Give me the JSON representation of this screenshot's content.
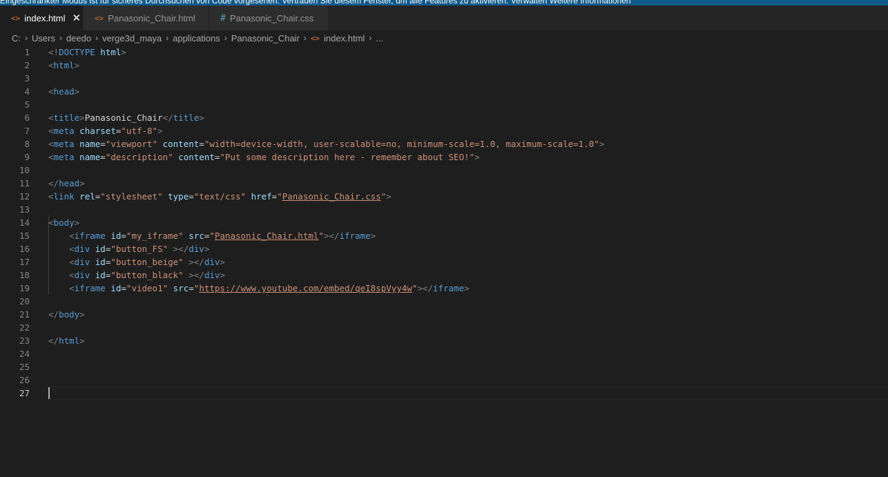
{
  "notification": {
    "text": "Eingeschränkter Modus ist für sicheres Durchsuchen von Code vorgesehen. Vertrauen Sie diesem Fenster, um alle Features zu aktivieren.   Verwalten   Weitere Informationen"
  },
  "tabs": [
    {
      "label": "index.html",
      "icon": "html-file-icon",
      "active": true
    },
    {
      "label": "Panasonic_Chair.html",
      "icon": "html-file-icon",
      "active": false
    },
    {
      "label": "Panasonic_Chair.css",
      "icon": "css-file-icon",
      "active": false
    }
  ],
  "breadcrumb": [
    "C:",
    "Users",
    "deedo",
    "verge3d_maya",
    "applications",
    "Panasonic_Chair",
    "index.html",
    "..."
  ],
  "editor": {
    "line_numbers": [
      "1",
      "2",
      "3",
      "4",
      "5",
      "6",
      "7",
      "8",
      "9",
      "10",
      "11",
      "12",
      "13",
      "14",
      "15",
      "16",
      "17",
      "18",
      "19",
      "20",
      "21",
      "22",
      "23",
      "24",
      "25",
      "26",
      "27"
    ],
    "line1": {
      "open": "<!",
      "kw": "DOCTYPE",
      "name": "html",
      "close": ">"
    },
    "line2": {
      "open": "<",
      "tag": "html",
      "close": ">"
    },
    "line4": {
      "open": "<",
      "tag": "head",
      "close": ">"
    },
    "line6": {
      "o1": "<",
      "tag": "title",
      "c1": ">",
      "text": "Panasonic_Chair",
      "o2": "</",
      "c2": ">"
    },
    "line7": {
      "open": "<",
      "tag": "meta",
      "attr": "charset",
      "eq": "=",
      "val": "\"utf-8\"",
      "close": ">"
    },
    "line8": {
      "open": "<",
      "tag": "meta",
      "a1": "name",
      "eq": "=",
      "v1": "\"viewport\"",
      "a2": "content",
      "v2": "\"width=device-width, user-scalable=no, minimum-scale=1.0, maximum-scale=1.0\"",
      "close": ">"
    },
    "line9": {
      "open": "<",
      "tag": "meta",
      "a1": "name",
      "eq": "=",
      "v1": "\"description\"",
      "a2": "content",
      "v2": "\"Put some description here - remember about SEO!\"",
      "close": ">"
    },
    "line11": {
      "open": "</",
      "tag": "head",
      "close": ">"
    },
    "line12": {
      "open": "<",
      "tag": "link",
      "a1": "rel",
      "eq": "=",
      "v1": "\"stylesheet\"",
      "a2": "type",
      "v2": "\"text/css\"",
      "a3": "href",
      "q": "\"",
      "link": "Panasonic_Chair.css",
      "close": ">"
    },
    "line14": {
      "open": "<",
      "tag": "body",
      "close": ">"
    },
    "line15": {
      "indent": "    ",
      "open": "<",
      "tag": "iframe",
      "a1": "id",
      "eq": "=",
      "v1": "\"my_iframe\"",
      "a2": "src",
      "q": "\"",
      "link": "Panasonic_Chair.html",
      "mid": "></",
      "close": ">"
    },
    "line16": {
      "indent": "    ",
      "open": "<",
      "tag": "div",
      "a1": "id",
      "eq": "=",
      "v1": "\"button_FS\"",
      "mid": " ></",
      "close": ">"
    },
    "line17": {
      "indent": "    ",
      "open": "<",
      "tag": "div",
      "a1": "id",
      "eq": "=",
      "v1": "\"button_beige\"",
      "mid": " ></",
      "close": ">"
    },
    "line18": {
      "indent": "    ",
      "open": "<",
      "tag": "div",
      "a1": "id",
      "eq": "=",
      "v1": "\"button_black\"",
      "mid": " ></",
      "close": ">"
    },
    "line19": {
      "indent": "    ",
      "open": "<",
      "tag": "iframe",
      "a1": "id",
      "eq": "=",
      "v1": "\"video1\"",
      "a2": "src",
      "q": "\"",
      "link": "https://www.youtube.com/embed/qeI8spVyy4w",
      "mid": "></",
      "close": ">"
    },
    "line21": {
      "open": "</",
      "tag": "body",
      "close": ">"
    },
    "line23": {
      "open": "</",
      "tag": "html",
      "close": ">"
    }
  }
}
